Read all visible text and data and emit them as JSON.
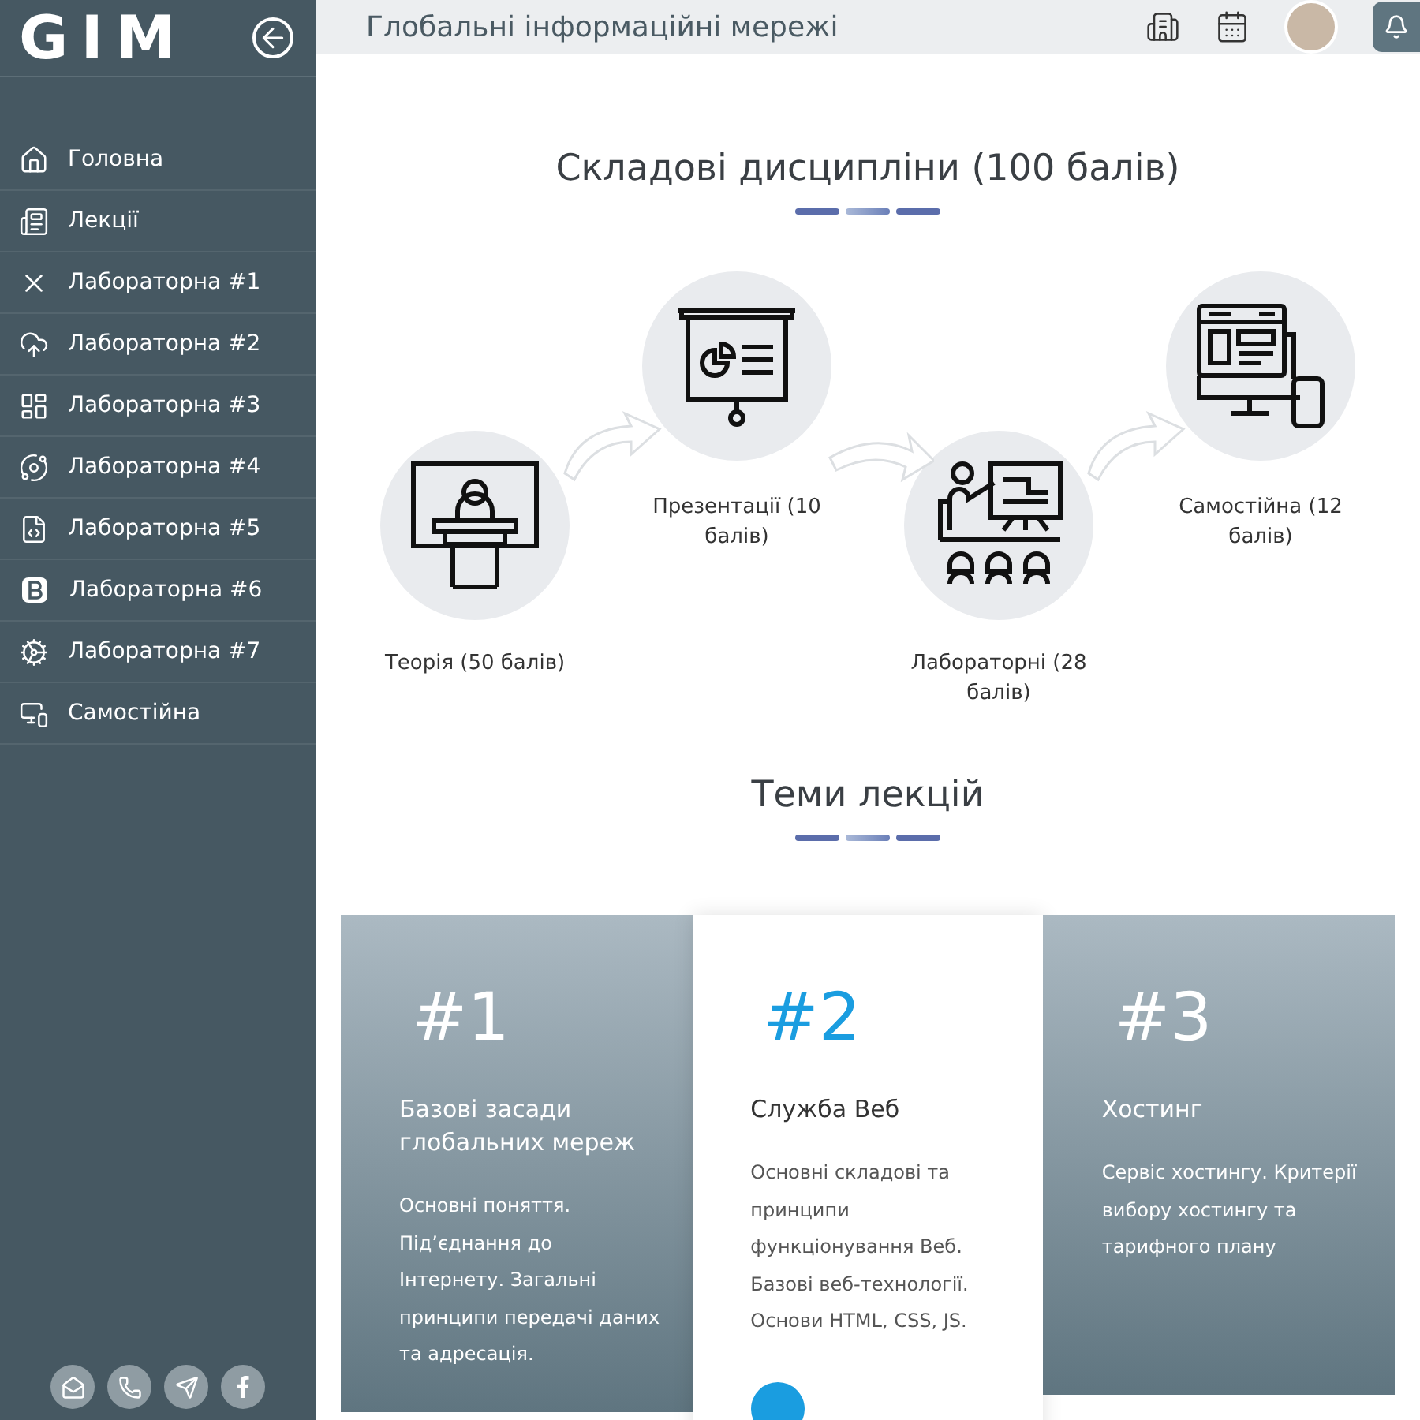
{
  "sidebar": {
    "logo": "GIM",
    "items": [
      {
        "label": "Головна"
      },
      {
        "label": "Лекції"
      },
      {
        "label": "Лабораторна #1"
      },
      {
        "label": "Лабораторна #2"
      },
      {
        "label": "Лабораторна #3"
      },
      {
        "label": "Лабораторна #4"
      },
      {
        "label": "Лабораторна #5"
      },
      {
        "label": "Лабораторна #6"
      },
      {
        "label": "Лабораторна #7"
      },
      {
        "label": "Самостійна"
      }
    ],
    "contacts": [
      {
        "kind": "mail"
      },
      {
        "kind": "phone"
      },
      {
        "kind": "telegram"
      },
      {
        "kind": "facebook"
      }
    ]
  },
  "header": {
    "title": "Глобальні інформаційні мережі"
  },
  "components": {
    "title": "Складові дисципліни (100 балів)",
    "steps": [
      {
        "label": "Теорія (50 балів)",
        "kind": "teacher"
      },
      {
        "label": "Презентації (10 балів)",
        "kind": "presentation"
      },
      {
        "label": "Лабораторні (28 балів)",
        "kind": "classroom"
      },
      {
        "label": "Самостійна (12 балів)",
        "kind": "devices"
      }
    ]
  },
  "lectures": {
    "title": "Теми лекцій",
    "cards": [
      {
        "number": "#1",
        "title": "Базові засади глобальних мереж",
        "text": "Основні поняття. Під’єднання до Інтернету. Загальні принципи передачі даних та адресація.",
        "selected": false
      },
      {
        "number": "#2",
        "title": "Служба Веб",
        "text": "Основні складові та принципи функціонування Веб. Базові веб-технології. Основи HTML, CSS, JS.",
        "selected": true
      },
      {
        "number": "#3",
        "title": "Хостинг",
        "text": "Сервіс хостингу. Критерії вибору хостингу та тарифного плану",
        "selected": false
      }
    ]
  }
}
